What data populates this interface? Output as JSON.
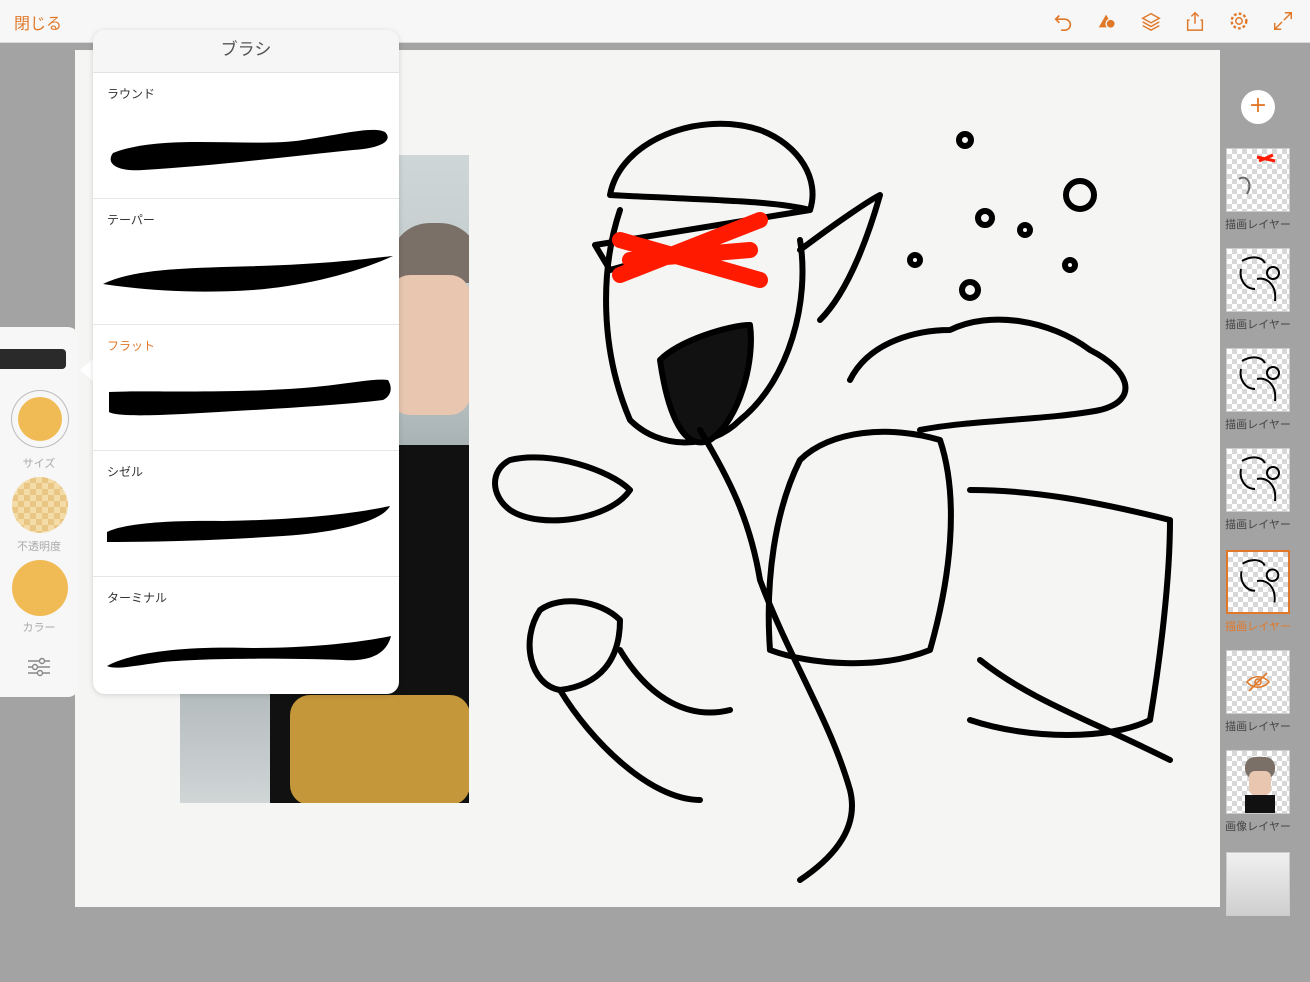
{
  "topbar": {
    "close_label": "閉じる",
    "tools": [
      "undo-icon",
      "shape-icon",
      "layers-icon",
      "share-icon",
      "gear-icon",
      "fullscreen-icon"
    ]
  },
  "colors": {
    "accent": "#e0782a",
    "swatch": "#f0bb55"
  },
  "brush_popover": {
    "title": "ブラシ",
    "brushes": [
      {
        "name": "ラウンド"
      },
      {
        "name": "テーパー"
      },
      {
        "name": "フラット"
      },
      {
        "name": "シゼル"
      },
      {
        "name": "ターミナル"
      }
    ],
    "selected": "フラット"
  },
  "toolstrip": {
    "size_label": "サイズ",
    "opacity_label": "不透明度",
    "color_label": "カラー"
  },
  "layers": [
    {
      "label": "描画レイヤー"
    },
    {
      "label": "描画レイヤー"
    },
    {
      "label": "描画レイヤー"
    },
    {
      "label": "描画レイヤー"
    },
    {
      "label": "描画レイヤー",
      "selected": true
    },
    {
      "label": "描画レイヤー",
      "hidden": true
    },
    {
      "label": "画像レイヤー"
    }
  ]
}
